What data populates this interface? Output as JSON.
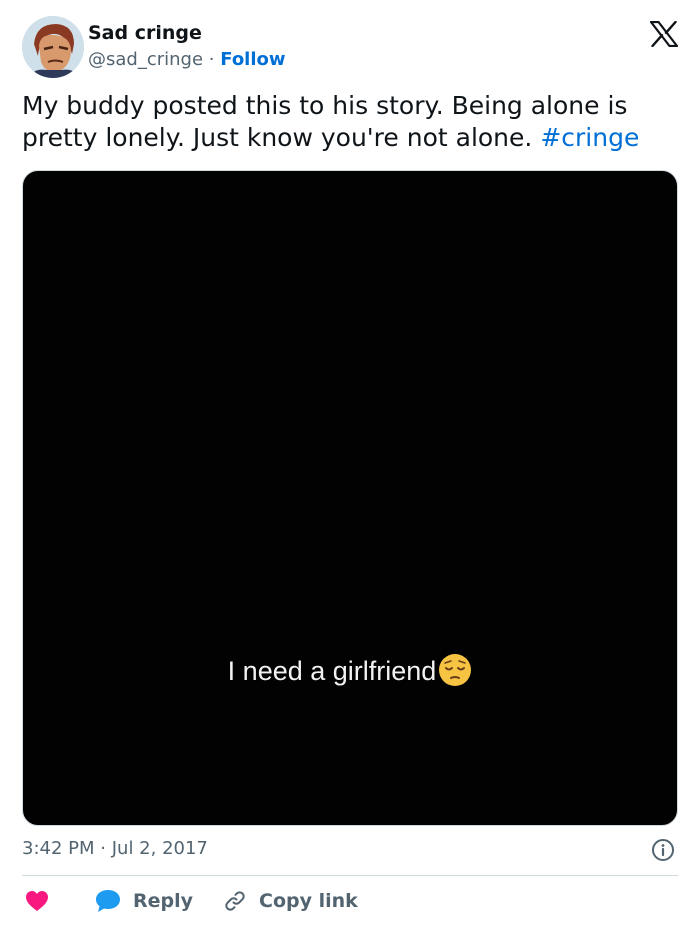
{
  "author": {
    "name": "Sad cringe",
    "handle": "@sad_cringe",
    "separator": "·",
    "follow_label": "Follow"
  },
  "tweet": {
    "text": "My buddy posted this to his story. Being alone is pretty lonely. Just know you're not alone.",
    "hashtag": "#cringe"
  },
  "media": {
    "caption": "I need a girlfriend",
    "emoji": "pensive-face-emoji"
  },
  "meta": {
    "time": "3:42 PM",
    "separator": "·",
    "date": "Jul 2, 2017"
  },
  "actions": {
    "reply_label": "Reply",
    "copy_link_label": "Copy link"
  },
  "colors": {
    "link": "#006fd6",
    "like": "#f91880",
    "reply": "#1d9bf0",
    "secondary_text": "#536471",
    "media_bg": "#020202"
  },
  "icons": [
    "x-logo-icon",
    "info-icon",
    "heart-icon",
    "speech-bubble-icon",
    "link-icon"
  ]
}
